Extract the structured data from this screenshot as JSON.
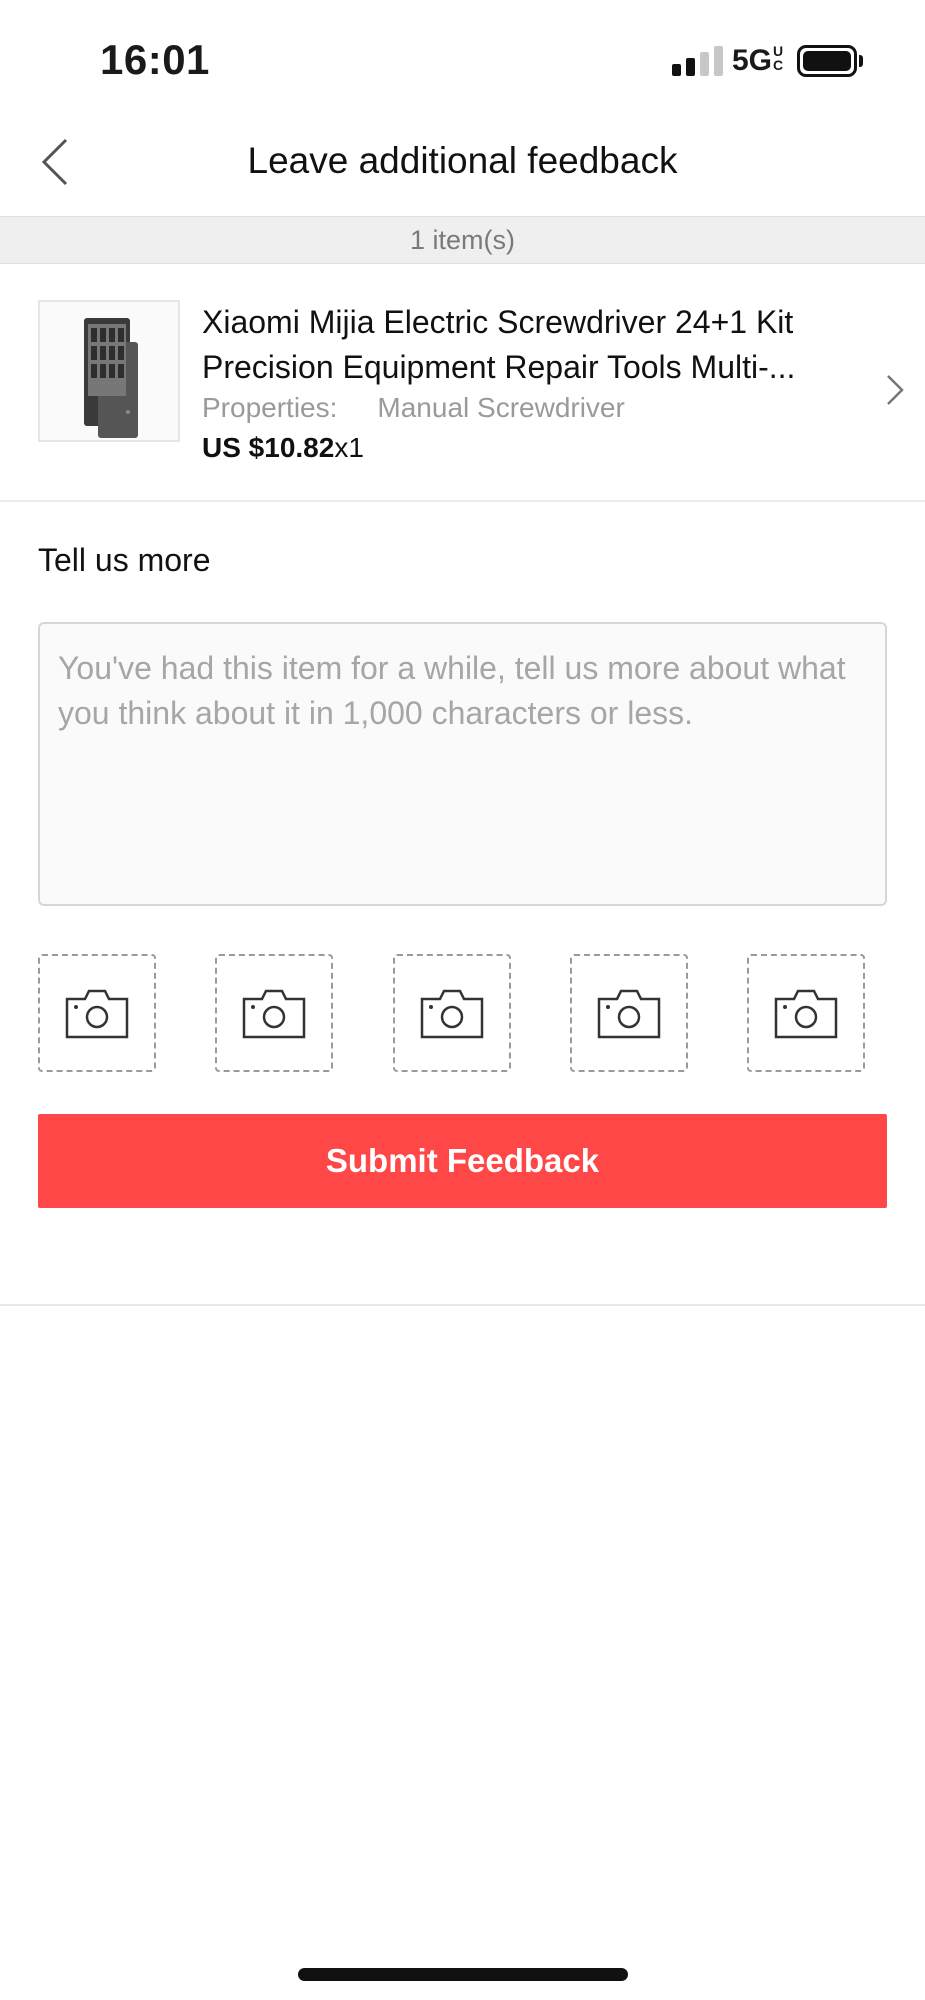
{
  "status_bar": {
    "time": "16:01",
    "network": "5G",
    "network_suffix": "UC",
    "signal_bars_active": 2,
    "signal_bars_total": 4,
    "battery_level": 1.0
  },
  "header": {
    "title": "Leave additional feedback",
    "back_icon": "chevron-left-icon"
  },
  "items_count": "1 item(s)",
  "product": {
    "title": "Xiaomi Mijia Electric Screwdriver 24+1 Kit Precision Equipment Repair Tools Multi-...",
    "properties_label": "Properties:",
    "properties_value": "Manual Screwdriver",
    "price": "US $10.82",
    "quantity": "x1",
    "chevron_icon": "chevron-right-icon"
  },
  "feedback": {
    "label": "Tell us more",
    "placeholder": "You've had this item for a while, tell us more about what you think about it in 1,000 characters or less.",
    "value": ""
  },
  "photos": {
    "slots": [
      "camera-icon",
      "camera-icon",
      "camera-icon",
      "camera-icon",
      "camera-icon"
    ]
  },
  "submit": {
    "label": "Submit Feedback",
    "color": "#ff4747"
  }
}
